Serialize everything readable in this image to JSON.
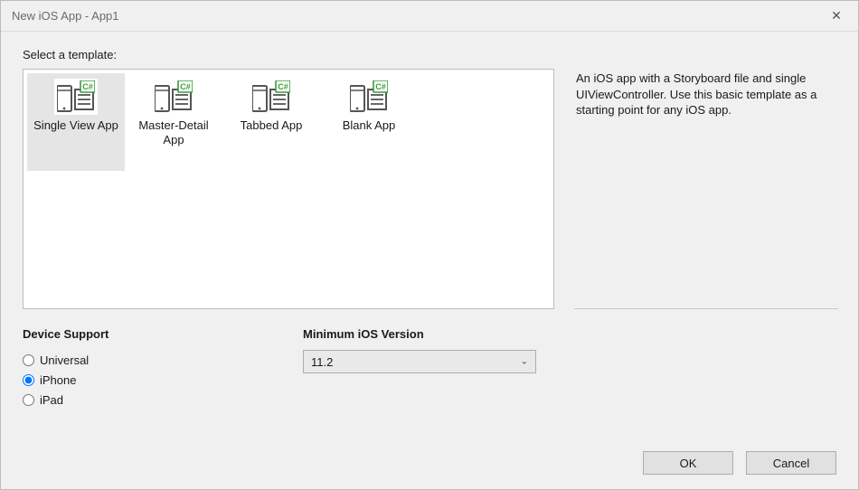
{
  "window": {
    "title": "New iOS App - App1"
  },
  "prompt": "Select a template:",
  "templates": [
    {
      "label": "Single View App",
      "selected": true
    },
    {
      "label": "Master-Detail App",
      "selected": false
    },
    {
      "label": "Tabbed App",
      "selected": false
    },
    {
      "label": "Blank App",
      "selected": false
    }
  ],
  "description": "An iOS app with a Storyboard file and single UIViewController. Use this basic template as a starting point for any iOS app.",
  "device_support": {
    "heading": "Device Support",
    "options": [
      {
        "label": "Universal",
        "checked": false
      },
      {
        "label": "iPhone",
        "checked": true
      },
      {
        "label": "iPad",
        "checked": false
      }
    ]
  },
  "min_ios": {
    "heading": "Minimum iOS Version",
    "value": "11.2"
  },
  "buttons": {
    "ok": "OK",
    "cancel": "Cancel"
  }
}
